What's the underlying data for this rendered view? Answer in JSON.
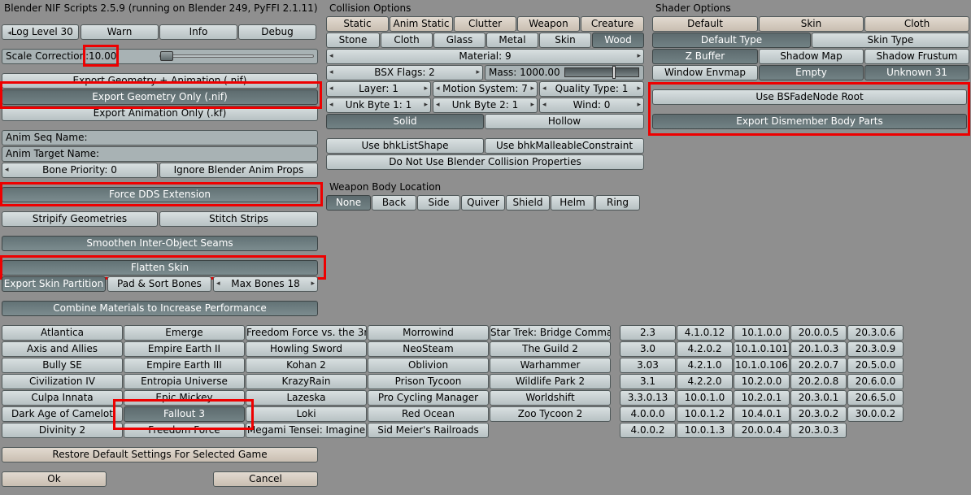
{
  "title": "Blender NIF Scripts 2.5.9 (running on Blender 249, PyFFI 2.1.11)",
  "log": {
    "level": "Log Level 30",
    "warn": "Warn",
    "info": "Info",
    "debug": "Debug"
  },
  "scale": {
    "label": "Scale Correction:",
    "value": "10.00"
  },
  "export": {
    "geom_anim": "Export Geometry + Animation (.nif)",
    "geom_only": "Export Geometry Only (.nif)",
    "anim_only": "Export Animation Only (.kf)"
  },
  "anim": {
    "seq_name": "Anim Seq Name:",
    "target_name": "Anim Target Name:",
    "bone_priority": "Bone Priority: 0",
    "ignore_props": "Ignore Blender Anim Props"
  },
  "options": {
    "force_dds": "Force DDS Extension",
    "stripify": "Stripify Geometries",
    "stitch": "Stitch Strips",
    "smoothen": "Smoothen Inter-Object Seams",
    "flatten": "Flatten Skin",
    "export_skin": "Export Skin Partition",
    "pad_sort": "Pad & Sort Bones",
    "max_bones": "Max Bones 18",
    "combine": "Combine Materials to Increase Performance"
  },
  "collision": {
    "header": "Collision Options",
    "types": [
      "Static",
      "Anim Static",
      "Clutter",
      "Weapon",
      "Creature"
    ],
    "materials": [
      "Stone",
      "Cloth",
      "Glass",
      "Metal",
      "Skin",
      "Wood"
    ],
    "material": "Material:  9",
    "bsx_flags": "BSX Flags:  2",
    "mass": "Mass:  1000.00",
    "layer": "Layer:  1",
    "motion_system": "Motion System:  7",
    "quality_type": "Quality Type:  1",
    "unk_byte1": "Unk Byte 1:  1",
    "unk_byte2": "Unk Byte 2:  1",
    "wind": "Wind:  0",
    "solid": "Solid",
    "hollow": "Hollow",
    "list_shape": "Use bhkListShape",
    "malleable": "Use bhkMalleableConstraint",
    "no_blender": "Do Not Use Blender Collision Properties"
  },
  "weapon": {
    "header": "Weapon Body Location",
    "items": [
      "None",
      "Back",
      "Side",
      "Quiver",
      "Shield",
      "Helm",
      "Ring"
    ]
  },
  "shader": {
    "header": "Shader Options",
    "row1": [
      "Default",
      "Skin",
      "Cloth"
    ],
    "default_type": "Default Type",
    "skin_type": "Skin Type",
    "row3": [
      "Z Buffer",
      "Shadow Map",
      "Shadow Frustum"
    ],
    "row4": [
      "Window Envmap",
      "Empty",
      "Unknown 31"
    ],
    "fadenode": "Use BSFadeNode Root",
    "dismember": "Export Dismember Body Parts"
  },
  "games": [
    [
      "Atlantica",
      "Emerge",
      "Freedom Force vs. the 3r",
      "Morrowind",
      "Star Trek: Bridge Comman"
    ],
    [
      "Axis and Allies",
      "Empire Earth II",
      "Howling Sword",
      "NeoSteam",
      "The Guild 2"
    ],
    [
      "Bully SE",
      "Empire Earth III",
      "Kohan 2",
      "Oblivion",
      "Warhammer"
    ],
    [
      "Civilization IV",
      "Entropia Universe",
      "KrazyRain",
      "Prison Tycoon",
      "Wildlife Park 2"
    ],
    [
      "Culpa Innata",
      "Epic Mickey",
      "Lazeska",
      "Pro Cycling Manager",
      "Worldshift"
    ],
    [
      "Dark Age of Camelot",
      "Fallout 3",
      "Loki",
      "Red Ocean",
      "Zoo Tycoon 2"
    ],
    [
      "Divinity 2",
      "Freedom Force",
      "Megami Tensei: Imagine",
      "Sid Meier's Railroads",
      ""
    ]
  ],
  "selected_game": "Fallout 3",
  "versions": [
    [
      "2.3",
      "4.1.0.12",
      "10.1.0.0",
      "20.0.0.5",
      "20.3.0.6"
    ],
    [
      "3.0",
      "4.2.0.2",
      "10.1.0.101",
      "20.1.0.3",
      "20.3.0.9"
    ],
    [
      "3.03",
      "4.2.1.0",
      "10.1.0.106",
      "20.2.0.7",
      "20.5.0.0"
    ],
    [
      "3.1",
      "4.2.2.0",
      "10.2.0.0",
      "20.2.0.8",
      "20.6.0.0"
    ],
    [
      "3.3.0.13",
      "10.0.1.0",
      "10.2.0.1",
      "20.3.0.1",
      "20.6.5.0"
    ],
    [
      "4.0.0.0",
      "10.0.1.2",
      "10.4.0.1",
      "20.3.0.2",
      "30.0.0.2"
    ],
    [
      "4.0.0.2",
      "10.0.1.3",
      "20.0.0.4",
      "20.3.0.3",
      ""
    ]
  ],
  "footer": {
    "restore": "Restore Default Settings For Selected Game",
    "ok": "Ok",
    "cancel": "Cancel"
  },
  "colors": {
    "highlight": "#ee0000",
    "panel": "#8f8f8f",
    "button": "#c4cdcf",
    "active": "#6b7a7d"
  }
}
